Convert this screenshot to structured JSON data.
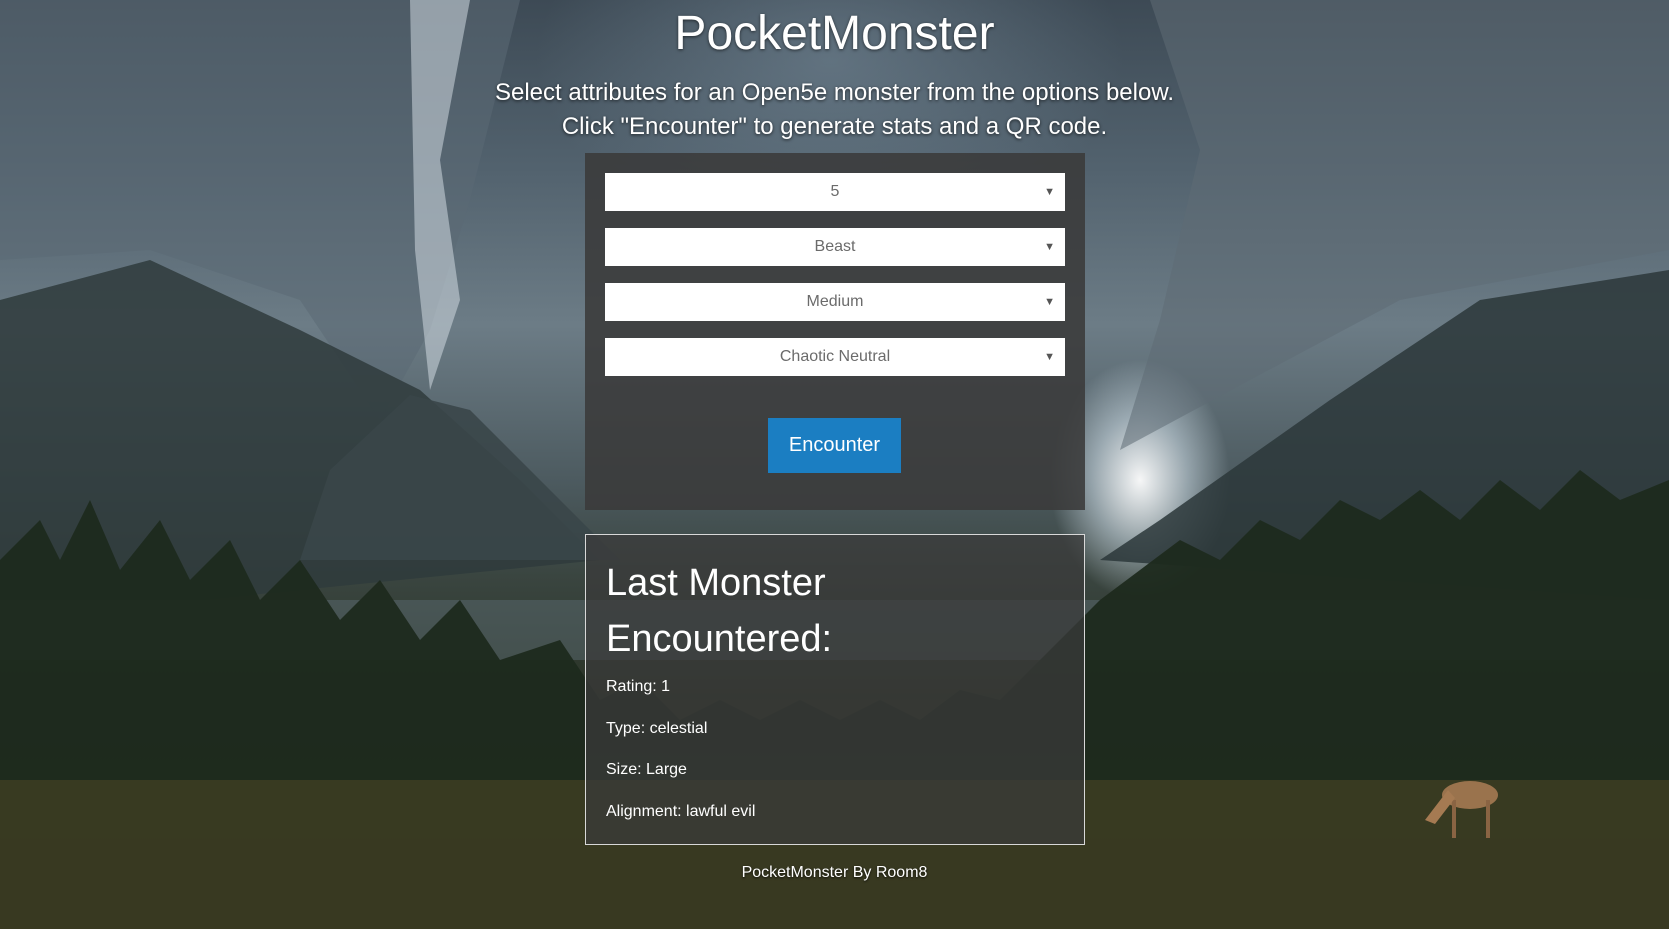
{
  "header": {
    "title": "PocketMonster",
    "subtitle_line1": "Select attributes for an Open5e monster from the options below.",
    "subtitle_line2": "Click \"Encounter\" to generate stats and a QR code."
  },
  "form": {
    "rating": "5",
    "type": "Beast",
    "size": "Medium",
    "alignment": "Chaotic Neutral",
    "encounter_label": "Encounter"
  },
  "last_monster": {
    "heading": "Last Monster Encountered:",
    "rating": "Rating: 1",
    "type": "Type: celestial",
    "size": "Size: Large",
    "alignment": "Alignment: lawful evil"
  },
  "footer": {
    "text": "PocketMonster By Room8"
  },
  "colors": {
    "button": "#1b7ec2",
    "panel": "#3a3a3a"
  },
  "icons": {
    "dropdown": "chevron-down-icon"
  }
}
